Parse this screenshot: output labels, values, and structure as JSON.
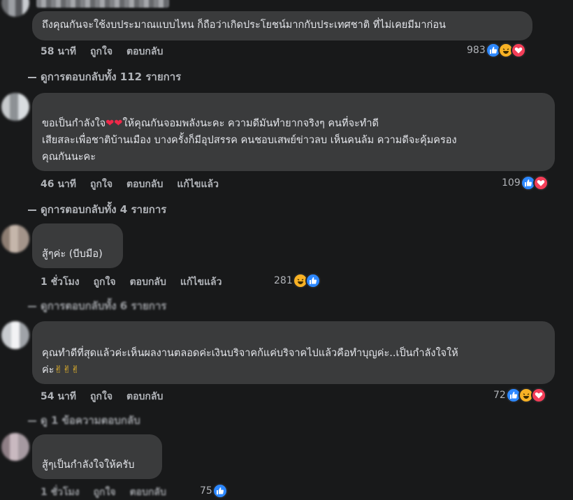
{
  "comments": [
    {
      "text": "ถึงคุณกันจะใช้งบประมาณแบบไหน ก็ถือว่าเกิดประโยชน์มากกับประเทศชาติ ที่ไม่เคยมีมาก่อน",
      "time": "58 นาที",
      "like": "ถูกใจ",
      "reply": "ตอบกลับ",
      "edited": "",
      "reaction_count": "983",
      "reactions": [
        "like-icon",
        "haha-icon",
        "love-icon"
      ],
      "replies_label": "ดูการตอบกลับทั้ง 112 รายการ"
    },
    {
      "text_part1": "ขอเป็นกำลังใจ",
      "text_hearts": "❤❤",
      "text_part2": "ให้คุณกันจอมพลังนะคะ ความดีมันทำยากจริงๆ คนที่จะทำดี\nเสียสละเพื่อชาติบ้านเมือง บางครั้งก็มีอุปสรรค คนชอบเสพย์ข่าวลบ เห็นคนล้ม ความดีจะคุ้มครอง\nคุณกันนะคะ",
      "time": "46 นาที",
      "like": "ถูกใจ",
      "reply": "ตอบกลับ",
      "edited": "แก้ไขแล้ว",
      "reaction_count": "109",
      "reactions": [
        "like-icon",
        "love-icon"
      ],
      "replies_label": "ดูการตอบกลับทั้ง 4 รายการ"
    },
    {
      "text": "สู้ๆค่ะ (บีบมือ)",
      "time": "1 ชั่วโมง",
      "like": "ถูกใจ",
      "reply": "ตอบกลับ",
      "edited": "แก้ไขแล้ว",
      "reaction_count": "281",
      "reactions": [
        "haha-icon",
        "like-icon"
      ],
      "replies_label": "ดูการตอบกลับทั้ง 6 รายการ"
    },
    {
      "text_part1": "คุณทำดีที่สุดแล้วค่ะเห็นผลงานตลอดค่ะเงินบริจาคก้แค่บริจาคไปแล้วคือทำบุญค่ะ..เป็นกำลังใจให้\nค่ะ",
      "text_hands": "✌✌✌",
      "time": "54 นาที",
      "like": "ถูกใจ",
      "reply": "ตอบกลับ",
      "reaction_count": "72",
      "reactions": [
        "like-icon",
        "haha-icon",
        "love-icon"
      ],
      "replies_label": "ดู 1 ข้อความตอบกลับ"
    },
    {
      "text": "สู้ๆเป็นกำลังใจให้ครับ",
      "time": "1 ชั่วโมง",
      "like": "ถูกใจ",
      "reply": "ตอบกลับ",
      "reaction_count": "75",
      "reactions": [
        "like-icon"
      ]
    }
  ],
  "colors": {
    "background": "#18191a",
    "bubble": "#3a3b3c",
    "text": "#e4e6eb",
    "secondary": "#b0b3b8",
    "like": "#2d88ff",
    "love": "#f33e58",
    "haha": "#f7b125"
  }
}
